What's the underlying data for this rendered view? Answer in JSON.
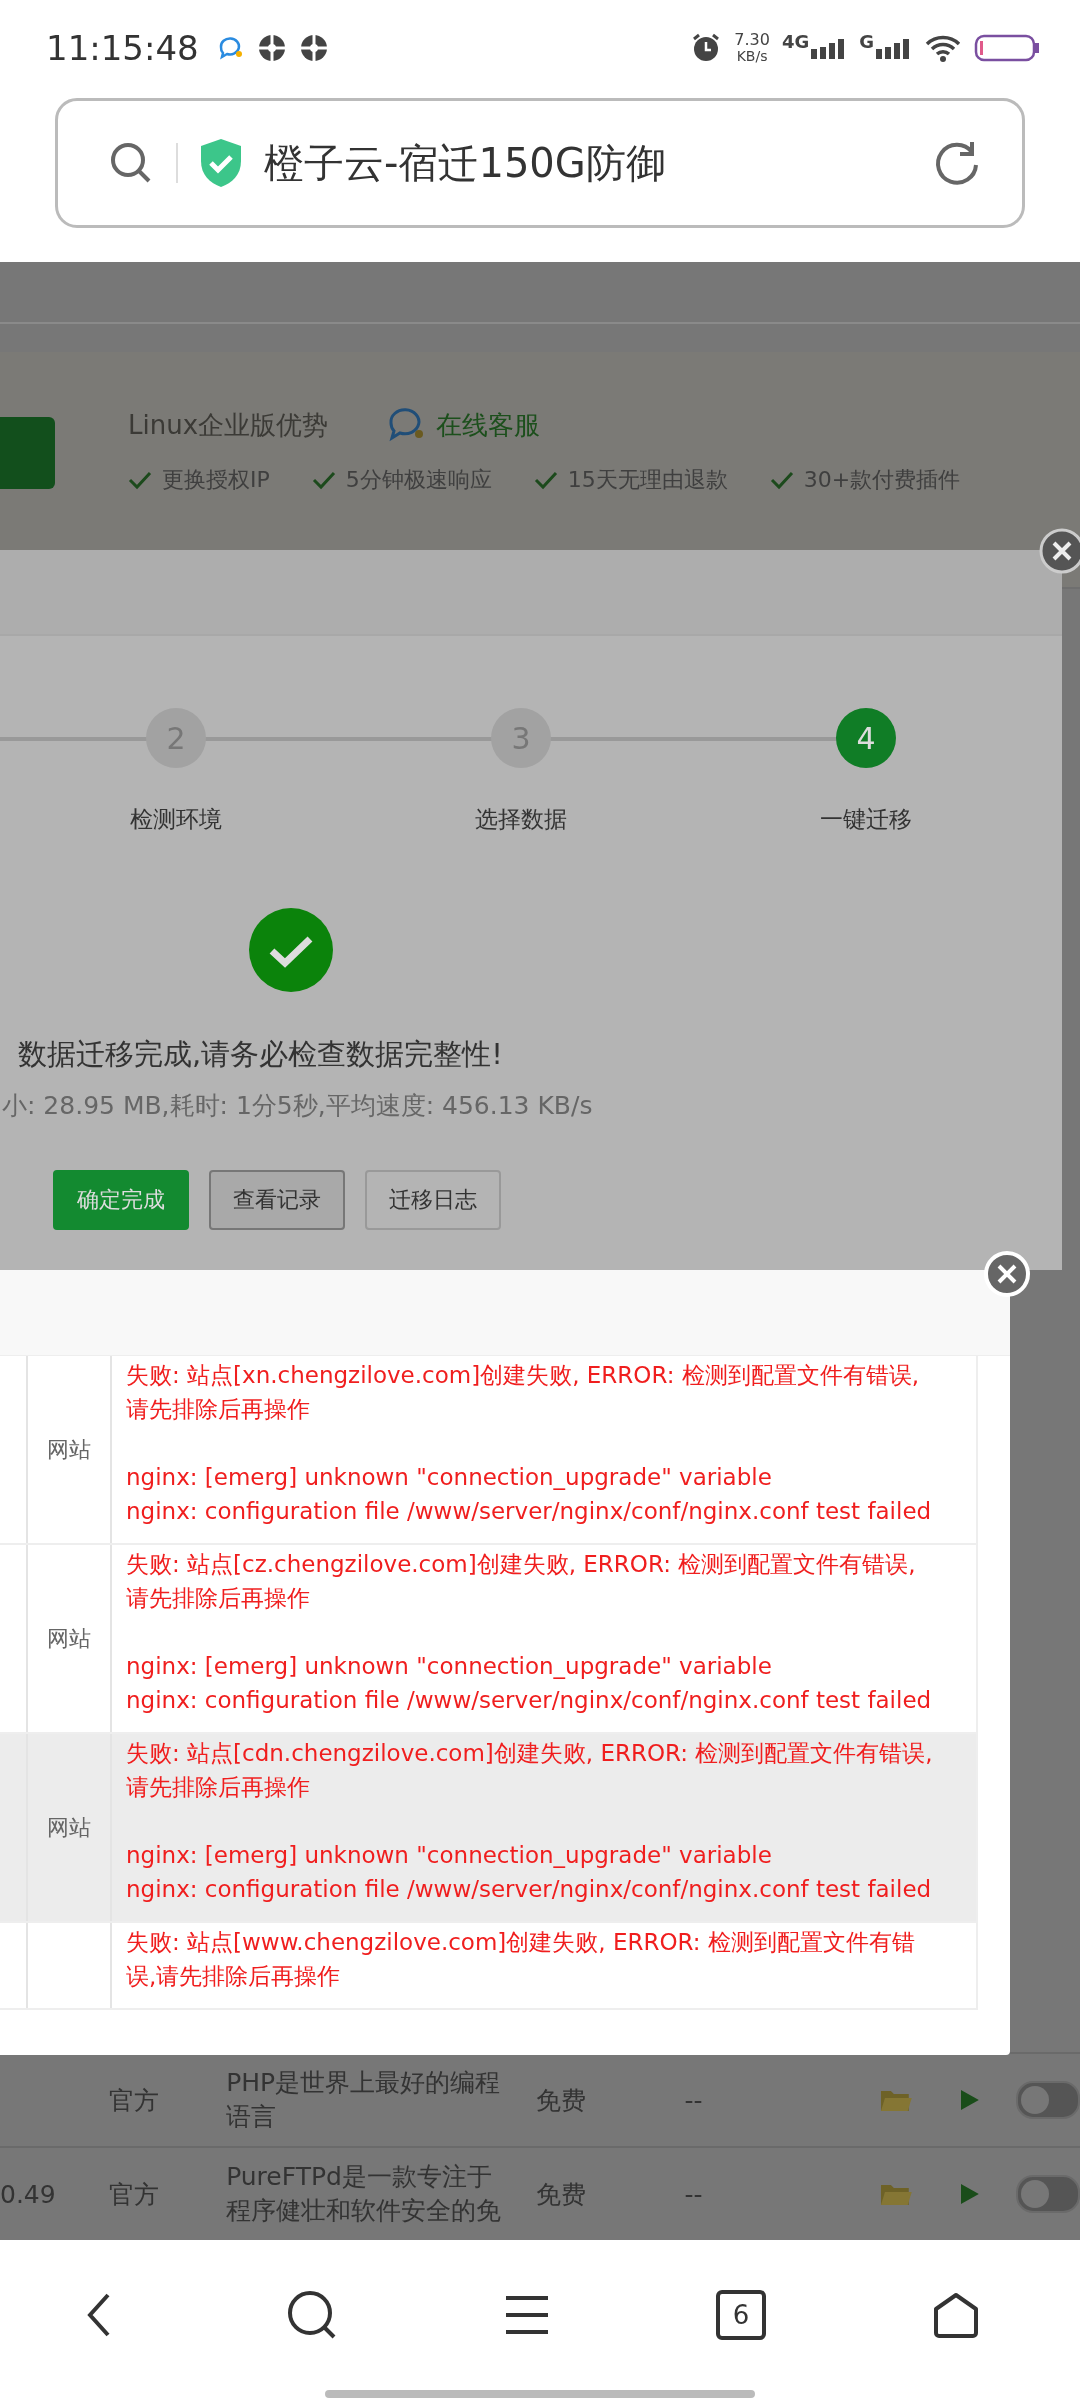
{
  "status_bar": {
    "time": "11:15:48",
    "net_speed": "7.30",
    "net_unit": "KB/s",
    "net_type_1": "4G",
    "net_type_2": "G"
  },
  "address_bar": {
    "title": "橙子云-宿迁150G防御"
  },
  "background_page": {
    "promo_title": "Linux企业版优势",
    "support_link": "在线客服",
    "features": [
      "更换授权IP",
      "5分钟极速响应",
      "15天无理由退款",
      "30+款付费插件"
    ],
    "rows": [
      {
        "column_1": "",
        "source": "官方",
        "description_lines": [
          "PHP是世界上最好的编程",
          "语言"
        ],
        "price": "免费",
        "expiry": "--",
        "on": false
      },
      {
        "column_1": "0.49",
        "source": "官方",
        "description_lines": [
          "PureFTPd是一款专注于",
          "程序健壮和软件安全的免"
        ],
        "price": "免费",
        "expiry": "--",
        "on": false
      }
    ]
  },
  "migration_dialog": {
    "steps": [
      {
        "number": "2",
        "label": "检测环境",
        "selected": false
      },
      {
        "number": "3",
        "label": "选择数据",
        "selected": false
      },
      {
        "number": "4",
        "label": "一键迁移",
        "selected": true
      }
    ],
    "result_title": "数据迁移完成,请务必检查数据完整性!",
    "result_summary": "小: 28.95 MB,耗时: 1分5秒,平均速度: 456.13 KB/s",
    "buttons": [
      {
        "label": "确定完成",
        "kind": "primary"
      },
      {
        "label": "查看记录",
        "kind": "secondary"
      },
      {
        "label": "迁移日志",
        "kind": "default"
      }
    ]
  },
  "log_dialog": {
    "rows": [
      {
        "type": "网站",
        "message": "失败: 站点[xn.chengzilove.com]创建失败, ERROR: 检测到配置文件有错误,请先排除后再操作",
        "details": [
          "nginx: [emerg] unknown \"connection_upgrade\" variable",
          "nginx: configuration file /www/server/nginx/conf/nginx.conf test failed"
        ],
        "highlighted": false
      },
      {
        "type": "网站",
        "message": "失败: 站点[cz.chengzilove.com]创建失败, ERROR: 检测到配置文件有错误,请先排除后再操作",
        "details": [
          "nginx: [emerg] unknown \"connection_upgrade\" variable",
          "nginx: configuration file /www/server/nginx/conf/nginx.conf test failed"
        ],
        "highlighted": false
      },
      {
        "type": "网站",
        "message": "失败: 站点[cdn.chengzilove.com]创建失败, ERROR: 检测到配置文件有错误,请先排除后再操作",
        "details": [
          "nginx: [emerg] unknown \"connection_upgrade\" variable",
          "nginx: configuration file /www/server/nginx/conf/nginx.conf test failed"
        ],
        "highlighted": true
      },
      {
        "type": "",
        "message": "失败: 站点[www.chengzilove.com]创建失败, ERROR: 检测到配置文件有错误,请先排除后再操作",
        "details": [],
        "highlighted": false
      }
    ]
  },
  "nav_bar": {
    "tab_count": "6"
  }
}
